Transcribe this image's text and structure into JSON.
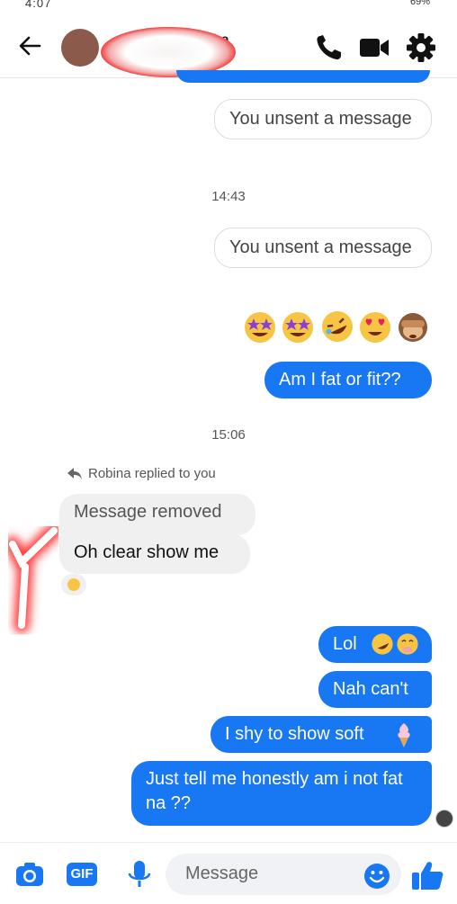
{
  "status_bar": {
    "left_text": "4:07",
    "right_text": "69%"
  },
  "header": {
    "contact_name_visible": "ha",
    "contact_sub_visible": "go"
  },
  "messages": {
    "unsent_1": "You unsent a message",
    "time_1": "14:43",
    "unsent_2": "You unsent a message",
    "emoji_row": [
      "star-struck-emoji",
      "star-struck-emoji",
      "rolling-laughing-emoji",
      "heart-eyes-emoji",
      "see-no-evil-monkey-emoji"
    ],
    "out_1": "Am I fat or fit??",
    "time_2": "15:06",
    "reply_note": "Robina replied to you",
    "in_removed": "Message removed",
    "in_1": "Oh clear show me",
    "reaction": "blushing-emoji",
    "out_2": "Lol",
    "out_3": "Nah can't",
    "out_4": "I shy to show soft",
    "out_5": "Just tell me honestly am i not fat na ??"
  },
  "composer": {
    "placeholder": "Message",
    "gif_label": "GIF"
  },
  "colors": {
    "accent": "#1877f2",
    "incoming_bg": "#f0f0f0",
    "unsent_border": "#dadde1"
  }
}
